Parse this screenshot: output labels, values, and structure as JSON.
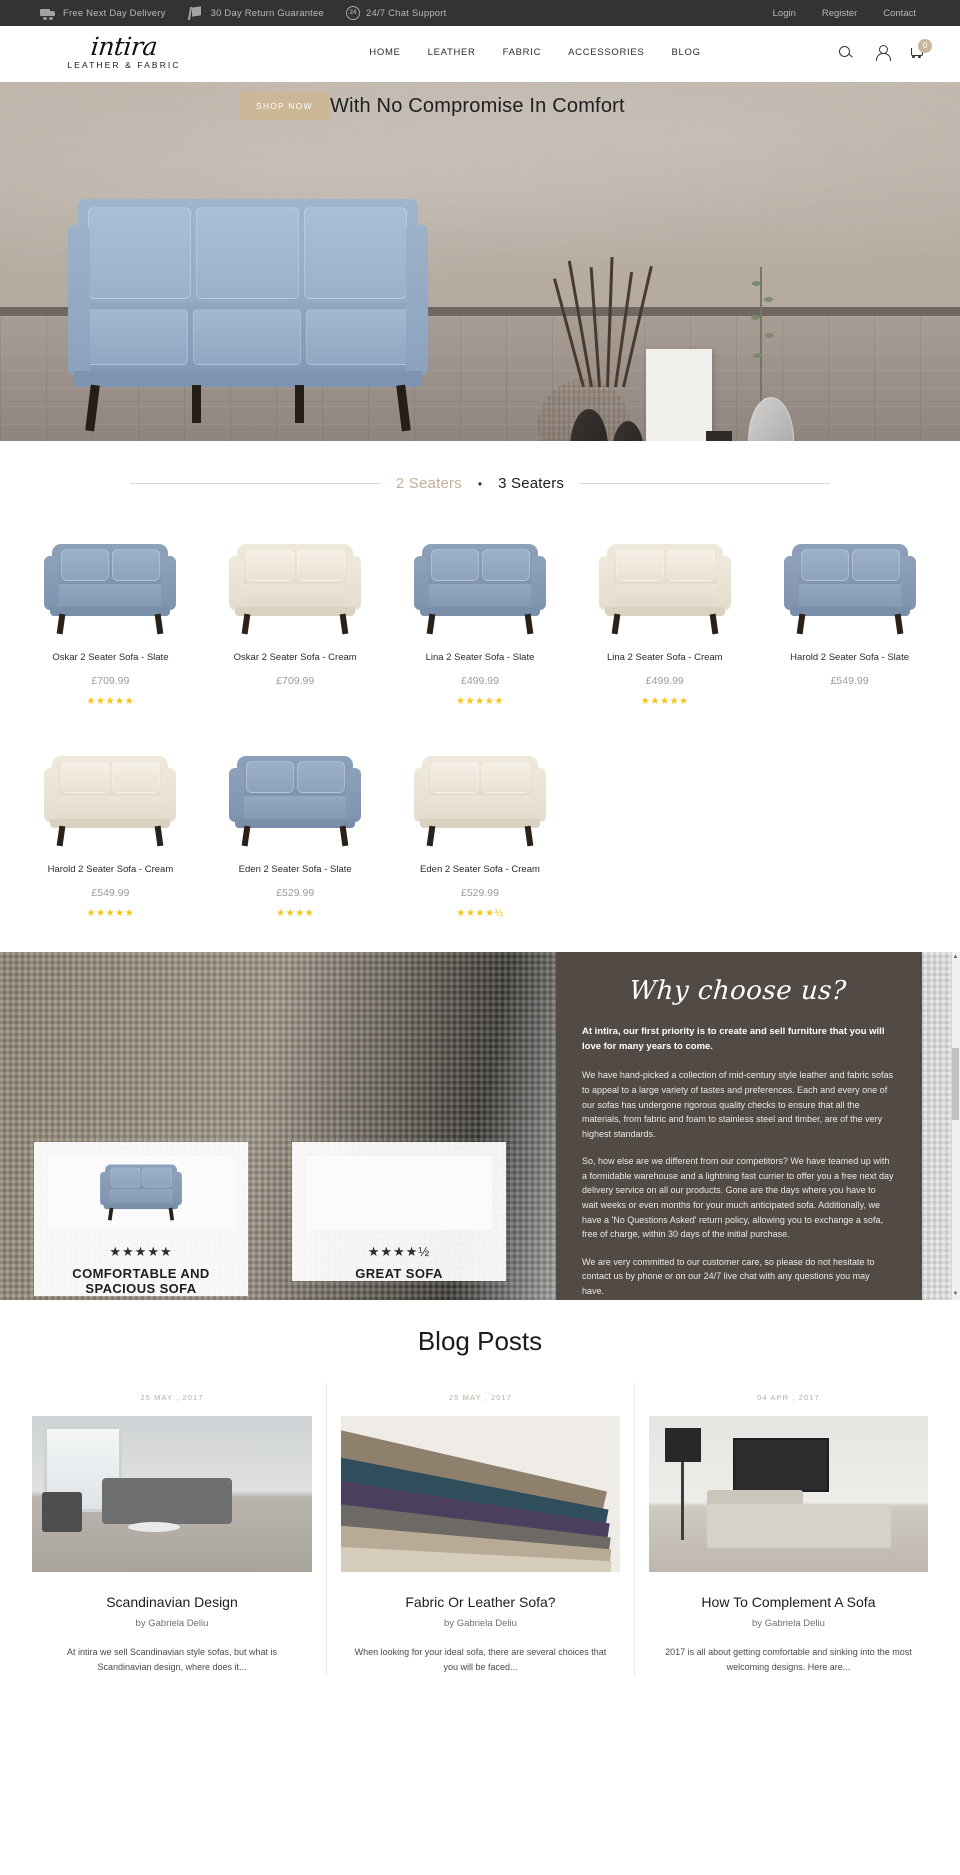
{
  "topbar": {
    "features": [
      {
        "icon": "truck-icon",
        "label": "Free Next Day Delivery"
      },
      {
        "icon": "return-box-icon",
        "label": "30 Day Return Guarantee"
      },
      {
        "icon": "chat-support-icon",
        "label": "24/7 Chat Support"
      }
    ],
    "chat_icon_text": "24",
    "links": [
      "Login",
      "Register",
      "Contact"
    ]
  },
  "header": {
    "brand_name": "intira",
    "brand_sub": "LEATHER & FABRIC",
    "nav": [
      "HOME",
      "LEATHER",
      "FABRIC",
      "ACCESSORIES",
      "BLOG"
    ],
    "icons": [
      "search-icon",
      "user-account-icon",
      "shopping-cart-icon"
    ],
    "cart_count": "0"
  },
  "hero": {
    "cta_label": "SHOP NOW",
    "headline": "With No Compromise In Comfort"
  },
  "catalog": {
    "tabs": [
      {
        "label": "2 Seaters",
        "active": true
      },
      {
        "label": "3 Seaters",
        "active": false
      }
    ],
    "separator": "•",
    "products": [
      {
        "title": "Oskar 2 Seater Sofa - Slate",
        "price": "£709.99",
        "stars": "★★★★★",
        "colour": "slate"
      },
      {
        "title": "Oskar 2 Seater Sofa - Cream",
        "price": "£709.99",
        "stars": "",
        "colour": "cream"
      },
      {
        "title": "Lina 2 Seater Sofa - Slate",
        "price": "£499.99",
        "stars": "★★★★★",
        "colour": "slate"
      },
      {
        "title": "Lina 2 Seater Sofa - Cream",
        "price": "£499.99",
        "stars": "★★★★★",
        "colour": "cream"
      },
      {
        "title": "Harold 2 Seater Sofa - Slate",
        "price": "£549.99",
        "stars": "",
        "colour": "slate"
      },
      {
        "title": "Harold 2 Seater Sofa - Cream",
        "price": "£549.99",
        "stars": "★★★★★",
        "colour": "cream"
      },
      {
        "title": "Eden 2 Seater Sofa - Slate",
        "price": "£529.99",
        "stars": "★★★★",
        "colour": "slate"
      },
      {
        "title": "Eden 2 Seater Sofa - Cream",
        "price": "£529.99",
        "stars": "★★★★½",
        "colour": "cream"
      }
    ]
  },
  "why": {
    "title": "Why choose us?",
    "intro": "At intira, our first priority is to create and sell furniture that you will love for many years to come.",
    "paragraphs": [
      "We have hand-picked a collection of mid-century style leather and fabric sofas to appeal to a large variety of tastes and preferences. Each and every one of our sofas has undergone rigorous quality checks to ensure that all the materials, from fabric and foam to stainless steel and timber, are of the very highest standards.",
      "So, how else are we different from our competitors? We have teamed up with a formidable warehouse and a lightning fast currier to offer you a free next day delivery service on all our products. Gone are the days where you have to wait weeks or even months for your much anticipated sofa. Additionally, we have a 'No Questions Asked' return policy, allowing you to exchange a sofa, free of charge, within 30 days of the initial purchase.",
      "We are very committed to our customer care, so please do not hesitate to contact us by phone or on our 24/7 live chat with any questions you may have."
    ],
    "scroll_up": "▲",
    "scroll_down": "▼",
    "testimonials": [
      {
        "stars": "★★★★★",
        "heading": "COMFORTABLE AND SPACIOUS SOFA"
      },
      {
        "stars": "★★★★½",
        "heading": "GREAT SOFA"
      }
    ]
  },
  "blog": {
    "section_title": "Blog Posts",
    "posts": [
      {
        "date": "25 MAY , 2017",
        "title": "Scandinavian Design",
        "author": "by Gabriela Deliu",
        "excerpt": "At intira we sell Scandinavian style sofas, but what is Scandinavian design, where does it..."
      },
      {
        "date": "25 MAY , 2017",
        "title": "Fabric Or Leather Sofa?",
        "author": "by Gabriela Deliu",
        "excerpt": "When looking for your ideal sofa, there are several choices that you will be faced..."
      },
      {
        "date": "04 APR , 2017",
        "title": "How To Complement A Sofa",
        "author": "by Gabriela Deliu",
        "excerpt": "2017 is all about getting comfortable and sinking into the most welcoming designs. Here are..."
      }
    ]
  },
  "colors": {
    "accent_tan": "#c9b79f",
    "topbar_bg": "#333333",
    "panel_bg": "#514a45",
    "star_gold": "#f5c518"
  }
}
